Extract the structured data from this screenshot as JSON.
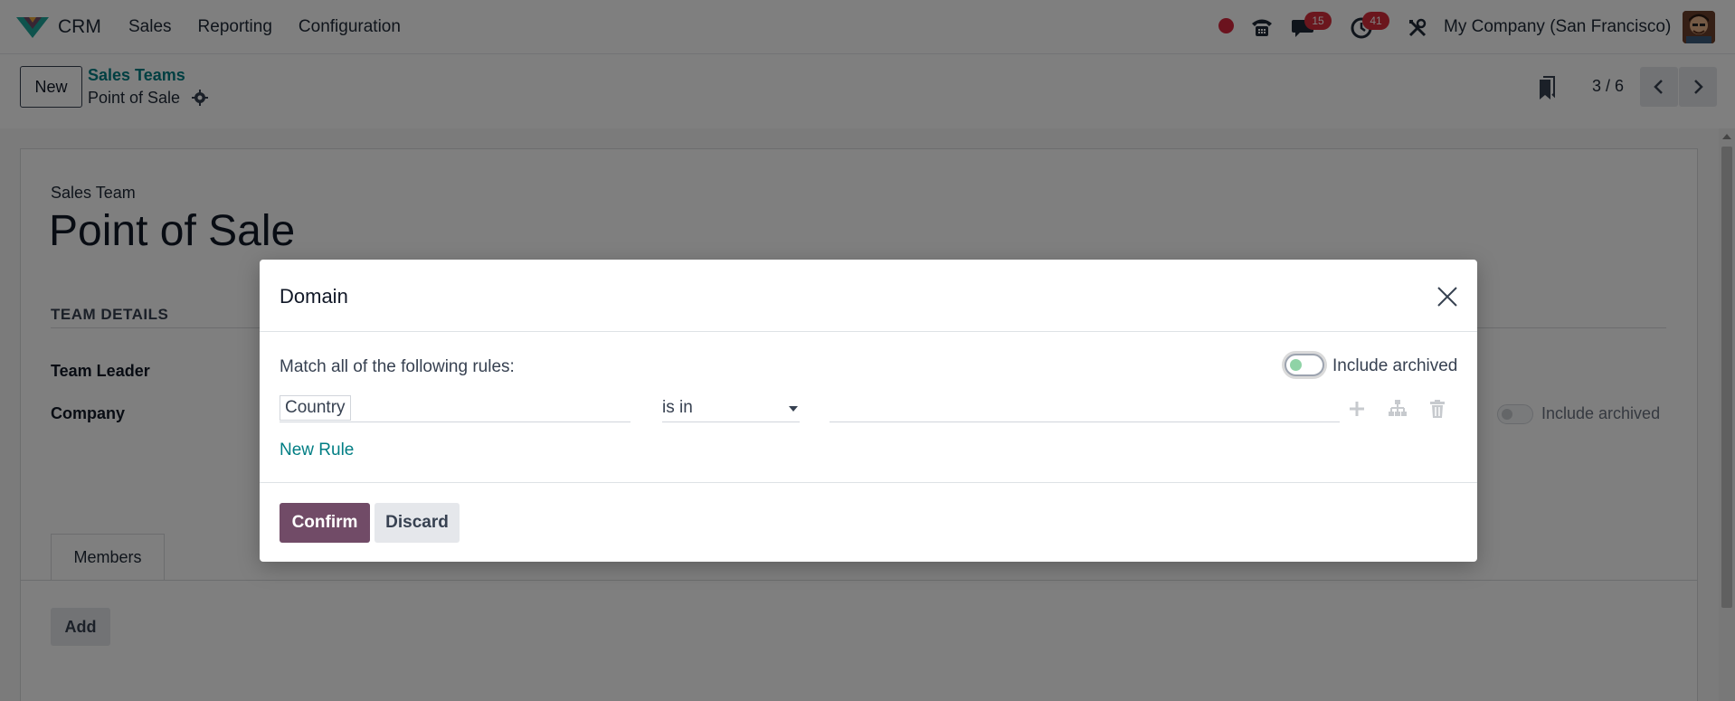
{
  "navbar": {
    "app_name": "CRM",
    "menu": [
      "Sales",
      "Reporting",
      "Configuration"
    ],
    "chat_badge": "15",
    "activity_badge": "41",
    "company": "My Company (San Francisco)",
    "icons": [
      "crm-logo-icon",
      "record-dot-icon",
      "phone-icon",
      "chat-icon",
      "activity-clock-icon",
      "tools-icon",
      "user-avatar"
    ]
  },
  "control_panel": {
    "new_label": "New",
    "breadcrumb_parent": "Sales Teams",
    "breadcrumb_current": "Point of Sale",
    "pager": "3 / 6"
  },
  "form": {
    "team_label": "Sales Team",
    "team_name": "Point of Sale",
    "section_title": "TEAM DETAILS",
    "field_team_leader": "Team Leader",
    "field_company": "Company",
    "include_archived": "Include archived",
    "tab_members": "Members",
    "add_label": "Add"
  },
  "modal": {
    "title": "Domain",
    "match_text": "Match all of the following rules:",
    "include_archived": "Include archived",
    "include_archived_on": false,
    "rule": {
      "field": "Country",
      "operator": "is in",
      "value": ""
    },
    "new_rule": "New Rule",
    "confirm": "Confirm",
    "discard": "Discard"
  },
  "colors": {
    "brand": "#714b67",
    "link": "#017e84",
    "badge": "#d62c3a"
  }
}
